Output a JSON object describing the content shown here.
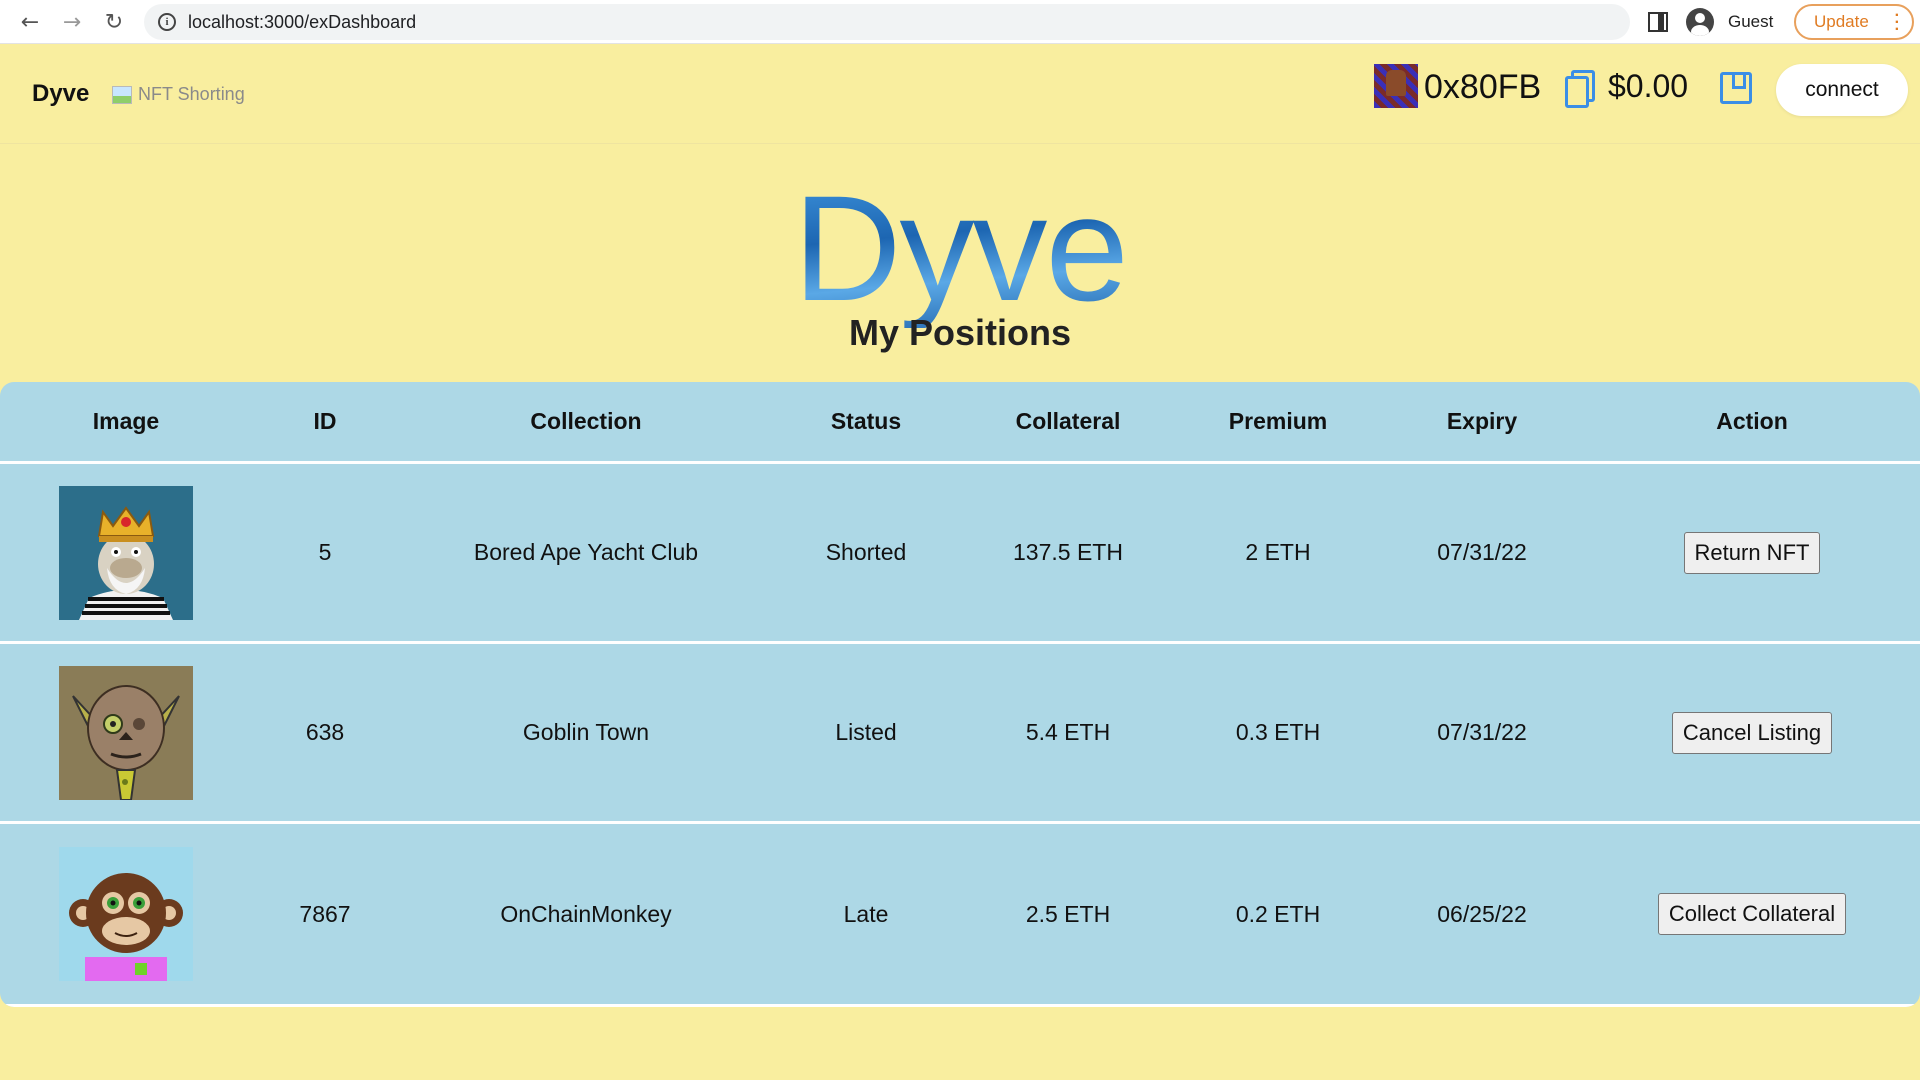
{
  "browser": {
    "url": "localhost:3000/exDashboard",
    "profile_name": "Guest",
    "update_label": "Update"
  },
  "header": {
    "brand": "Dyve",
    "subtitle": "NFT Shorting",
    "wallet_address": "0x80FB",
    "balance": "$0.00",
    "connect_label": "connect"
  },
  "hero": {
    "title": "Dyve",
    "subtitle": "My Positions"
  },
  "table": {
    "headers": [
      "Image",
      "ID",
      "Collection",
      "Status",
      "Collateral",
      "Premium",
      "Expiry",
      "Action"
    ],
    "rows": [
      {
        "id": "5",
        "collection": "Bored Ape Yacht Club",
        "status": "Shorted",
        "collateral": "137.5 ETH",
        "premium": "2 ETH",
        "expiry": "07/31/22",
        "action": "Return NFT"
      },
      {
        "id": "638",
        "collection": "Goblin Town",
        "status": "Listed",
        "collateral": "5.4 ETH",
        "premium": "0.3 ETH",
        "expiry": "07/31/22",
        "action": "Cancel Listing"
      },
      {
        "id": "7867",
        "collection": "OnChainMonkey",
        "status": "Late",
        "collateral": "2.5 ETH",
        "premium": "0.2 ETH",
        "expiry": "06/25/22",
        "action": "Collect Collateral"
      }
    ]
  },
  "colors": {
    "page_background": "#f9ee9f",
    "table_background": "#add8e6",
    "accent_blue": "#3b8ee6",
    "update_orange": "#e07b22"
  }
}
